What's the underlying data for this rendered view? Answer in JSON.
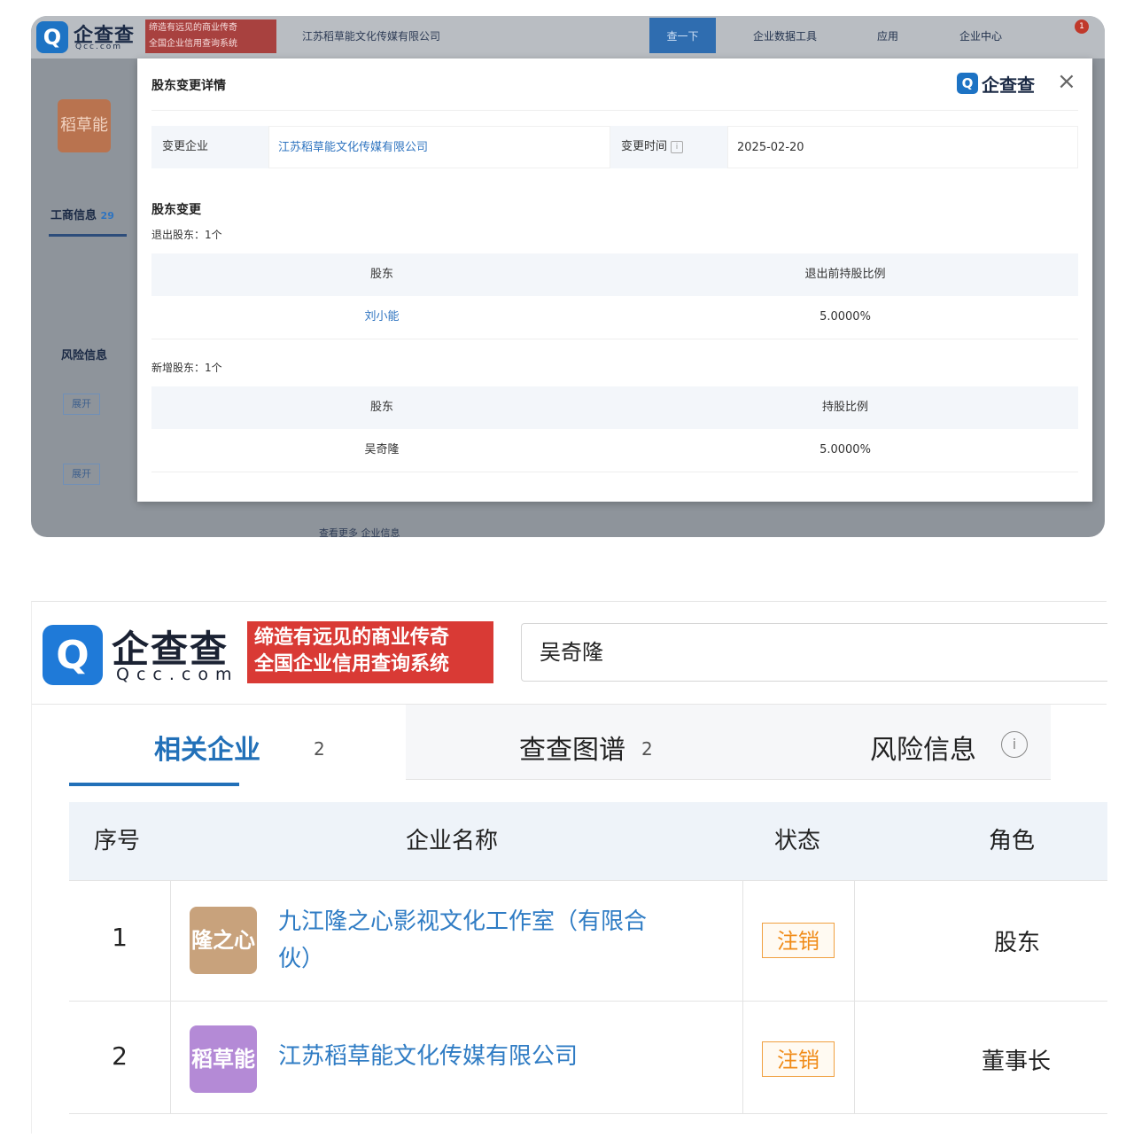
{
  "top": {
    "header": {
      "logo_text": "企查查",
      "logo_sub": "Qcc.com",
      "slogan_line1": "缔造有远见的商业传奇",
      "slogan_line2": "全国企业信用查询系统",
      "search_value": "江苏稻草能文化传媒有限公司",
      "search_button": "查一下",
      "nav1": "企业数据工具",
      "nav2": "应用",
      "nav3": "企业中心",
      "notif_count": "1"
    },
    "bg": {
      "avatar_text": "稻草能",
      "tab_label": "工商信息",
      "tab_count": "29",
      "side_title": "风险信息",
      "side_b1": "展开",
      "side_b2": "展开",
      "bottom_text": "查看更多 企业信息"
    },
    "modal": {
      "title": "股东变更详情",
      "logo_text": "企查查",
      "close": "×",
      "label_company": "变更企业",
      "company": "江苏稻草能文化传媒有限公司",
      "label_date": "变更时间",
      "date": "2025-02-20",
      "section_title": "股东变更",
      "sub_exit": "退出股东：1个",
      "table1": {
        "headers": [
          "股东",
          "退出前持股比例"
        ],
        "rows": [
          [
            "刘小能",
            "5.0000%"
          ]
        ]
      },
      "sub_new": "新增股东：1个",
      "table2": {
        "headers": [
          "股东",
          "持股比例"
        ],
        "rows": [
          [
            "吴奇隆",
            "5.0000%"
          ]
        ]
      }
    }
  },
  "bottom": {
    "logo_text": "企查查",
    "logo_sub": "Qcc.com",
    "slogan_line1": "缔造有远见的商业传奇",
    "slogan_line2": "全国企业信用查询系统",
    "search_value": "吴奇隆",
    "tabs": [
      {
        "label": "相关企业",
        "count": "2"
      },
      {
        "label": "查查图谱",
        "count": "2"
      },
      {
        "label": "风险信息"
      }
    ],
    "columns": [
      "序号",
      "企业名称",
      "状态",
      "角色"
    ],
    "rows": [
      {
        "seq": "1",
        "logo": "隆之心",
        "name_l1": "九江隆之心影视文化工作室（有限合",
        "name_l2": "伙）",
        "status": "注销",
        "role": "股东"
      },
      {
        "seq": "2",
        "logo": "稻草能",
        "name_l1": "江苏稻草能文化传媒有限公司",
        "name_l2": "",
        "status": "注销",
        "role": "董事长"
      }
    ],
    "colors": {
      "accent": "#2270b8",
      "status": "#f08c1a",
      "logo1": "#c8a27c",
      "logo2": "#b48ad6"
    }
  }
}
